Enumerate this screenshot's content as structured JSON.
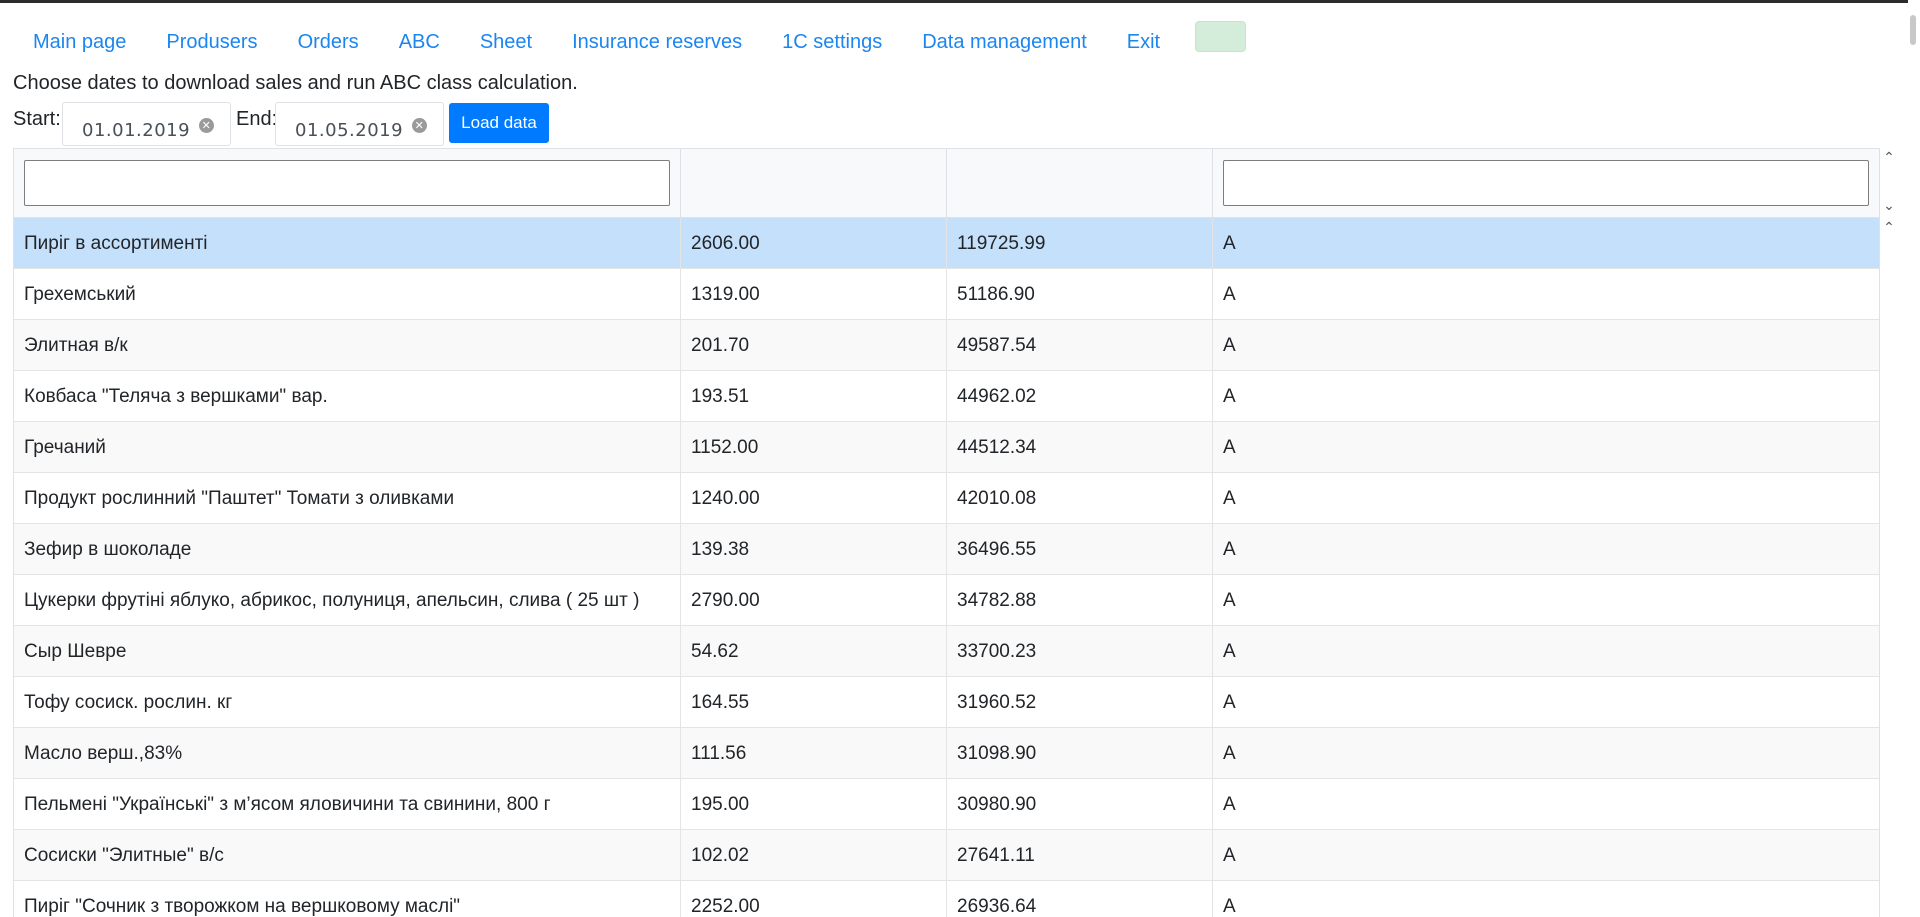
{
  "nav": {
    "items": [
      "Main page",
      "Produsers",
      "Orders",
      "ABC",
      "Sheet",
      "Insurance reserves",
      "1C settings",
      "Data management",
      "Exit"
    ]
  },
  "info_text": "Choose dates to download sales and run ABC class calculation.",
  "controls": {
    "start_label": "Start:",
    "start_date": "01.01.2019",
    "end_label": "End:",
    "end_date": "01.05.2019",
    "load_button": "Load data"
  },
  "table": {
    "filters": {
      "name": "",
      "class": ""
    },
    "rows": [
      [
        "Пиріг в ассортименті",
        "2606.00",
        "119725.99",
        "A"
      ],
      [
        "Грехемський",
        "1319.00",
        "51186.90",
        "A"
      ],
      [
        "Элитная в/к",
        "201.70",
        "49587.54",
        "A"
      ],
      [
        "Ковбаса \"Теляча з вершками\" вар.",
        "193.51",
        "44962.02",
        "A"
      ],
      [
        "Гречаний",
        "1152.00",
        "44512.34",
        "A"
      ],
      [
        "Продукт рослинний \"Паштет\" Томати з оливками",
        "1240.00",
        "42010.08",
        "A"
      ],
      [
        "Зефир в шоколаде",
        "139.38",
        "36496.55",
        "A"
      ],
      [
        "Цукерки фрутіні яблуко, абрикос, полуниця, апельсин, слива ( 25 шт )",
        "2790.00",
        "34782.88",
        "A"
      ],
      [
        "Сыр Шевре",
        "54.62",
        "33700.23",
        "A"
      ],
      [
        "Тофу сосиск. рослин. кг",
        "164.55",
        "31960.52",
        "A"
      ],
      [
        "Масло верш.,83%",
        "111.56",
        "31098.90",
        "A"
      ],
      [
        "Пельмені \"Українські\" з м’ясом яловичини та свинини, 800 г",
        "195.00",
        "30980.90",
        "A"
      ],
      [
        "Сосиски \"Элитные\" в/с",
        "102.02",
        "27641.11",
        "A"
      ],
      [
        "Пиріг \"Сочник з творожком на вершковому маслі\"",
        "2252.00",
        "26936.64",
        "A"
      ]
    ]
  },
  "colors": {
    "link": "#1b86f0",
    "button": "#007bff",
    "selected_row": "#c4e0fa",
    "badge": "#d4edda"
  }
}
